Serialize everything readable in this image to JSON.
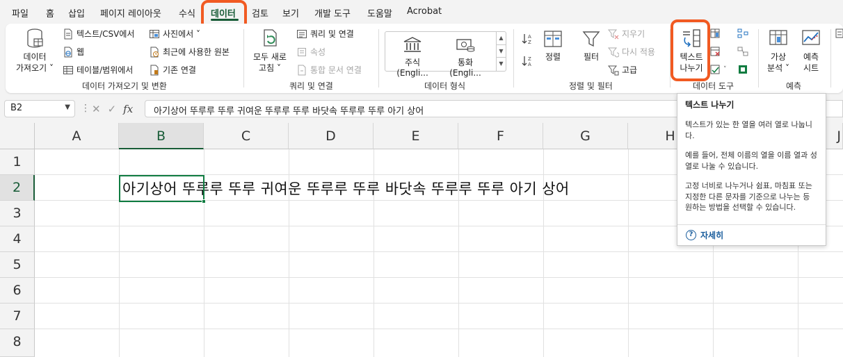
{
  "menu": {
    "tabs": [
      "파일",
      "홈",
      "삽입",
      "페이지 레이아웃",
      "수식",
      "데이터",
      "검토",
      "보기",
      "개발 도구",
      "도움말",
      "Acrobat"
    ],
    "active_tab": "데이터"
  },
  "ribbon": {
    "get_data": {
      "big_button": [
        "데이터",
        "가져오기 ˅"
      ],
      "from_text_csv": "텍스트/CSV에서",
      "from_web": "웹",
      "from_table_range": "테이블/범위에서",
      "from_picture": "사진에서 ˅",
      "recent_sources": "최근에 사용한 원본",
      "existing_connections": "기존 연결",
      "label": "데이터 가져오기 및 변환"
    },
    "queries": {
      "refresh_all": [
        "모두 새로",
        "고침 ˅"
      ],
      "queries_connections": "쿼리 및 연결",
      "properties": "속성",
      "edit_links": "통합 문서 연결",
      "label": "쿼리 및 연결"
    },
    "data_types": {
      "stocks": "주식 (Engli...",
      "currencies": "통화 (Engli...",
      "label": "데이터 형식"
    },
    "sort_filter": {
      "sort": "정렬",
      "filter": "필터",
      "clear": "지우기",
      "reapply": "다시 적용",
      "advanced": "고급",
      "label": "정렬 및 필터"
    },
    "data_tools": {
      "text_to_columns": [
        "텍스트",
        "나누기"
      ],
      "label": "데이터 도구"
    },
    "forecast": {
      "what_if": [
        "가상",
        "분석 ˅"
      ],
      "forecast_sheet": [
        "예측",
        "시트"
      ],
      "label": "예측"
    }
  },
  "formula_bar": {
    "name_box": "B2",
    "formula": "아기상어 뚜루루 뚜루 귀여운 뚜루루 뚜루 바닷속 뚜루루 뚜루 아기 상어"
  },
  "grid": {
    "columns": [
      "A",
      "B",
      "C",
      "D",
      "E",
      "F",
      "G",
      "H",
      "J"
    ],
    "rows": [
      "1",
      "2",
      "3",
      "4",
      "5",
      "6",
      "7",
      "8"
    ],
    "selected_cell": "B2",
    "cell_b2": "아기상어 뚜루루 뚜루 귀여운 뚜루루 뚜루 바닷속 뚜루루 뚜루 아기 상어"
  },
  "tooltip": {
    "title": "텍스트 나누기",
    "paragraphs": [
      "텍스트가 있는 한 열을 여러 열로 나눕니다.",
      "예를 들어, 전체 이름의 열을 이름 열과 성 열로 나눌 수 있습니다.",
      "고정 너비로 나누거나 쉼표, 마침표 또는 지정한 다른 문자를 기준으로 나누는 등 원하는 방법을 선택할 수 있습니다."
    ],
    "more_link": "자세히"
  },
  "colors": {
    "accent": "#185c37",
    "highlight": "#f15a22",
    "excel_green": "#107c41"
  }
}
